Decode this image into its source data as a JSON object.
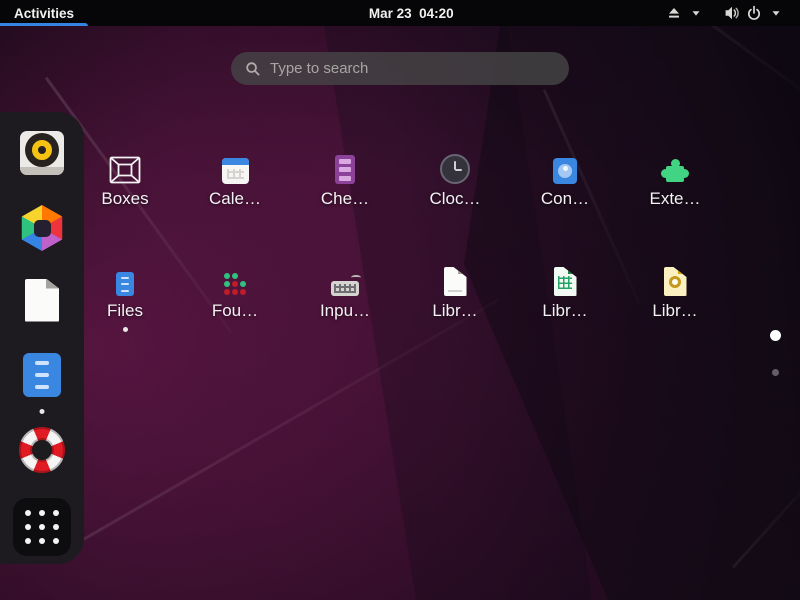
{
  "top_bar": {
    "activities_label": "Activities",
    "clock": "Mar 23  04:20",
    "accent_color": "#3584e4",
    "right_icons": [
      "eject-icon",
      "chevron-down-icon",
      "volume-icon",
      "power-icon",
      "chevron-down-icon"
    ]
  },
  "search": {
    "placeholder": "Type to search",
    "value": "",
    "icon": "search-icon"
  },
  "dock": {
    "items": [
      {
        "icon": "music-player-app-icon"
      },
      {
        "icon": "software-store-app-icon"
      },
      {
        "icon": "libreoffice-app-icon"
      },
      {
        "icon": "files-app-icon",
        "running": true
      },
      {
        "icon": "help-app-icon"
      },
      {
        "icon": "app-grid-button",
        "active": true
      }
    ]
  },
  "app_grid": {
    "apps": [
      {
        "label": "Boxes",
        "icon": "boxes-app-icon"
      },
      {
        "label": "Cale…",
        "icon": "calendar-app-icon"
      },
      {
        "label": "Che…",
        "icon": "cheese-app-icon"
      },
      {
        "label": "Cloc…",
        "icon": "clocks-app-icon"
      },
      {
        "label": "Con…",
        "icon": "contacts-app-icon"
      },
      {
        "label": "Exte…",
        "icon": "extensions-app-icon"
      },
      {
        "label": "Files",
        "icon": "files-app-icon",
        "running": true
      },
      {
        "label": "Fou…",
        "icon": "four-in-a-row-app-icon"
      },
      {
        "label": "Inpu…",
        "icon": "input-method-app-icon"
      },
      {
        "label": "Libr…",
        "icon": "libreoffice-start-app-icon"
      },
      {
        "label": "Libr…",
        "icon": "libreoffice-calc-app-icon"
      },
      {
        "label": "Libr…",
        "icon": "libreoffice-impress-app-icon"
      }
    ],
    "page_indicator": {
      "count": 2,
      "active_index": 0
    }
  }
}
